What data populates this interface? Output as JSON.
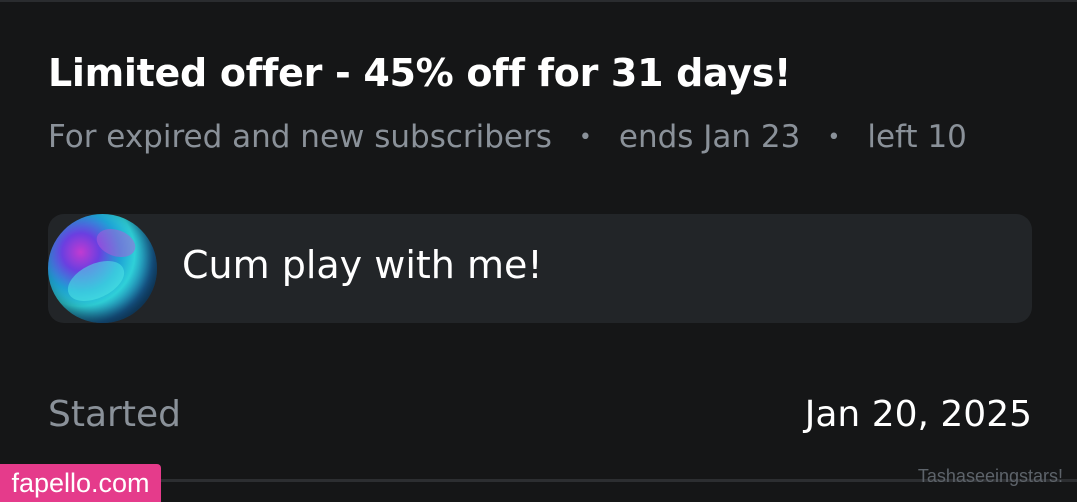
{
  "offer": {
    "title": "Limited offer - 45% off for 31 days!",
    "audience": "For expired and new subscribers",
    "ends": "ends Jan 23",
    "left": "left 10",
    "separator": "•"
  },
  "message": {
    "text": "Cum play with me!",
    "avatar_icon": "avatar-image"
  },
  "details": {
    "started_label": "Started",
    "started_value": "Jan 20, 2025"
  },
  "watermarks": {
    "site": "fapello.com",
    "username": "Tashaseeingstars!"
  },
  "colors": {
    "background": "#151617",
    "message_box": "#222528",
    "muted_text": "#8a9199",
    "watermark_badge": "#e53b8b"
  }
}
